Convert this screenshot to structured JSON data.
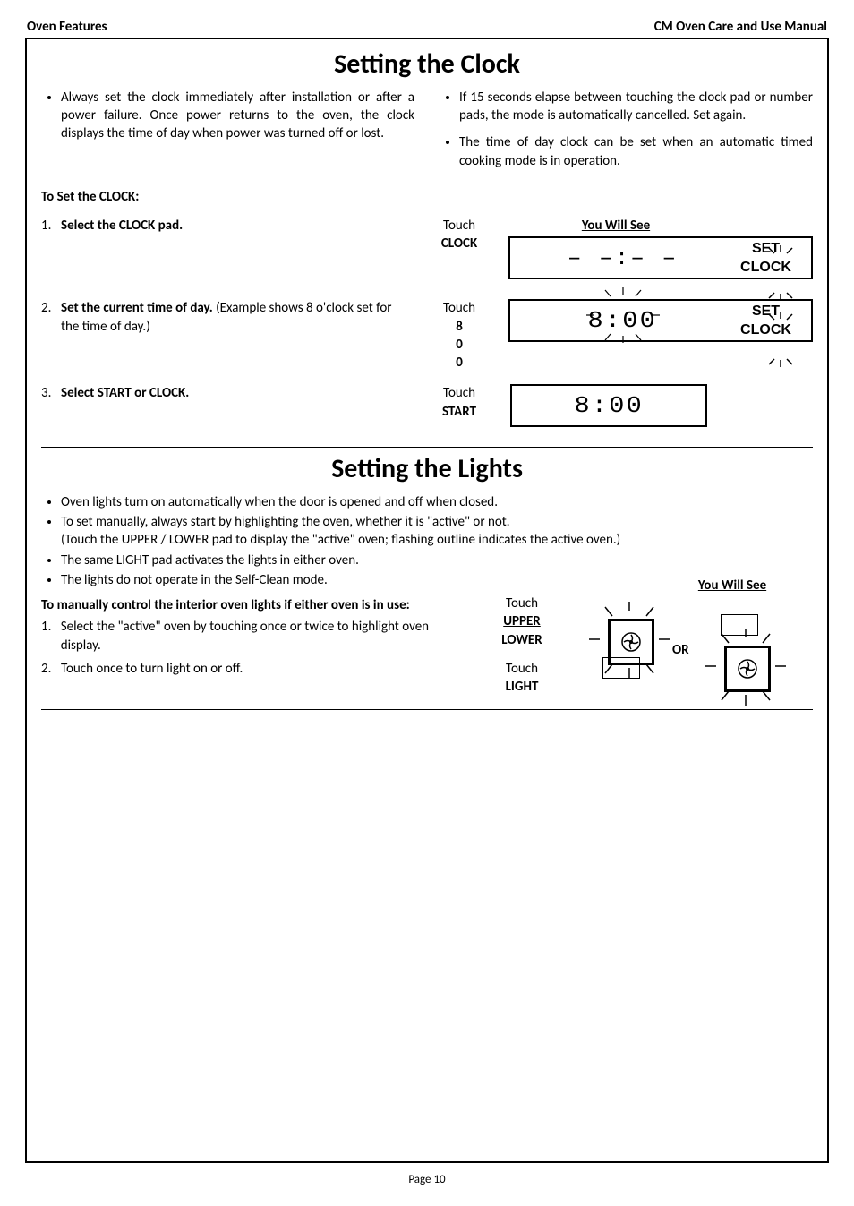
{
  "header": {
    "left": "Oven Features",
    "right": "CM Oven Care and Use Manual"
  },
  "clock": {
    "title": "Setting the Clock",
    "bullets_left": [
      "Always set the clock immediately after installation or after a power failure.  Once power returns to the oven, the clock displays the time of day when power was turned off or lost."
    ],
    "bullets_right": [
      "If 15 seconds elapse between touching the clock pad or number pads, the mode is automatically cancelled.  Set again.",
      "The time of day clock can be set when an automatic timed cooking mode is in operation."
    ],
    "to_set": "To Set the CLOCK:",
    "you_will_see": "You Will See",
    "steps": [
      {
        "num": "1.",
        "bold": "Select the CLOCK pad.",
        "rest": "",
        "touch": "Touch",
        "touch_bold": [
          "CLOCK"
        ],
        "disp_time": "– –:– –",
        "disp_label": "SET CLOCK",
        "disp_sun": true
      },
      {
        "num": "2.",
        "bold": "Set the current time of day.",
        "rest": "(Example shows 8 o'clock set for the time of day.)",
        "touch": "Touch",
        "touch_bold": [
          "8",
          "0",
          "0"
        ],
        "disp_time": "8:00",
        "disp_label": "SET CLOCK",
        "disp_sun": true,
        "time_sun": true
      },
      {
        "num": "3.",
        "bold": "Select START or CLOCK.",
        "rest": "",
        "touch": "Touch",
        "touch_bold": [
          "START"
        ],
        "disp_time": "8:00",
        "disp_label": "",
        "disp_sun": false
      }
    ]
  },
  "lights": {
    "title": "Setting the Lights",
    "bullets": [
      "Oven lights turn on automatically when the door is opened and off when closed.",
      "To set manually, always start by highlighting the oven, whether it is \"active\" or not.\n(Touch the UPPER / LOWER pad to display the \"active\" oven; flashing outline indicates the active oven.)",
      "The same LIGHT pad activates the lights in either oven.",
      "The lights do not operate in the Self-Clean mode."
    ],
    "you_will_see": "You Will See",
    "manual_heading": "To manually control the interior oven lights if either oven is in use:",
    "steps": [
      {
        "num": "1.",
        "text": "Select the \"active\" oven by touching once or twice to highlight oven display."
      },
      {
        "num": "2.",
        "text": "Touch once to turn light on or off."
      }
    ],
    "touch1": "Touch",
    "touch1_bold": [
      "UPPER",
      "LOWER"
    ],
    "touch2": "Touch",
    "touch2_bold": [
      "LIGHT"
    ],
    "or": "OR"
  },
  "footer": "Page 10"
}
